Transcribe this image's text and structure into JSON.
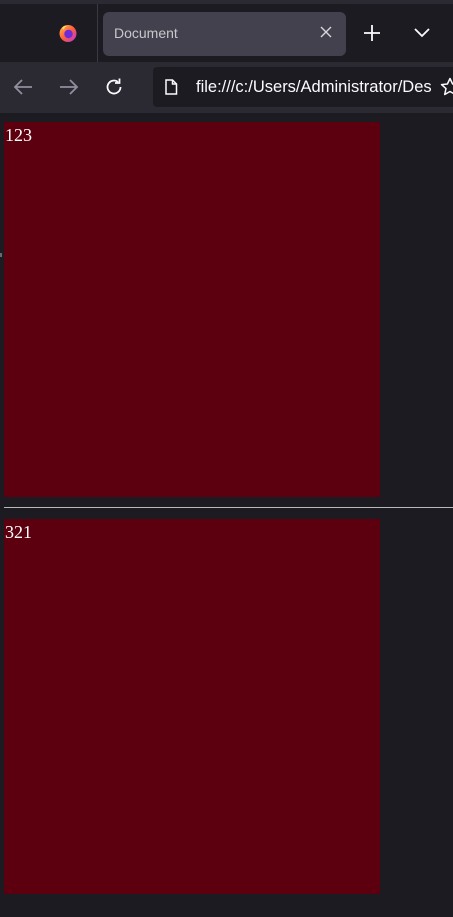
{
  "browser": {
    "tab_title": "Document",
    "url": "file:///c:/Users/Administrator/Desktop/"
  },
  "page": {
    "box1_text": "123",
    "box2_text": "321",
    "box_color": "#5c0010"
  }
}
